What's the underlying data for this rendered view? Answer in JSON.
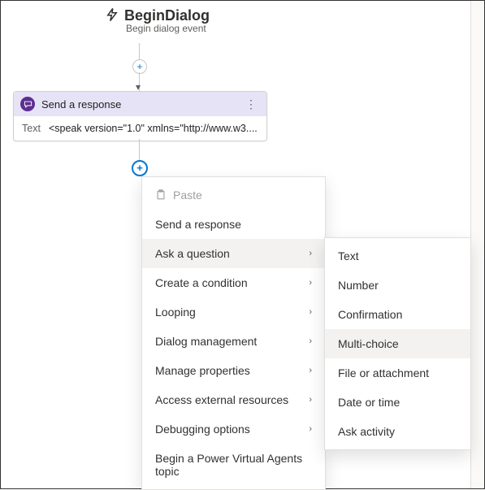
{
  "trigger": {
    "title": "BeginDialog",
    "subtitle": "Begin dialog event"
  },
  "node": {
    "title": "Send a response",
    "field_label": "Text",
    "field_value": "<speak version=\"1.0\" xmlns=\"http://www.w3...."
  },
  "menu": {
    "paste": "Paste",
    "items": [
      {
        "label": "Send a response",
        "submenu": false
      },
      {
        "label": "Ask a question",
        "submenu": true,
        "hovered": true
      },
      {
        "label": "Create a condition",
        "submenu": true
      },
      {
        "label": "Looping",
        "submenu": true
      },
      {
        "label": "Dialog management",
        "submenu": true
      },
      {
        "label": "Manage properties",
        "submenu": true
      },
      {
        "label": "Access external resources",
        "submenu": true
      },
      {
        "label": "Debugging options",
        "submenu": true
      },
      {
        "label": "Begin a Power Virtual Agents topic",
        "submenu": false
      }
    ]
  },
  "submenu": {
    "items": [
      {
        "label": "Text"
      },
      {
        "label": "Number"
      },
      {
        "label": "Confirmation"
      },
      {
        "label": "Multi-choice",
        "hovered": true
      },
      {
        "label": "File or attachment"
      },
      {
        "label": "Date or time"
      },
      {
        "label": "Ask activity"
      }
    ]
  }
}
